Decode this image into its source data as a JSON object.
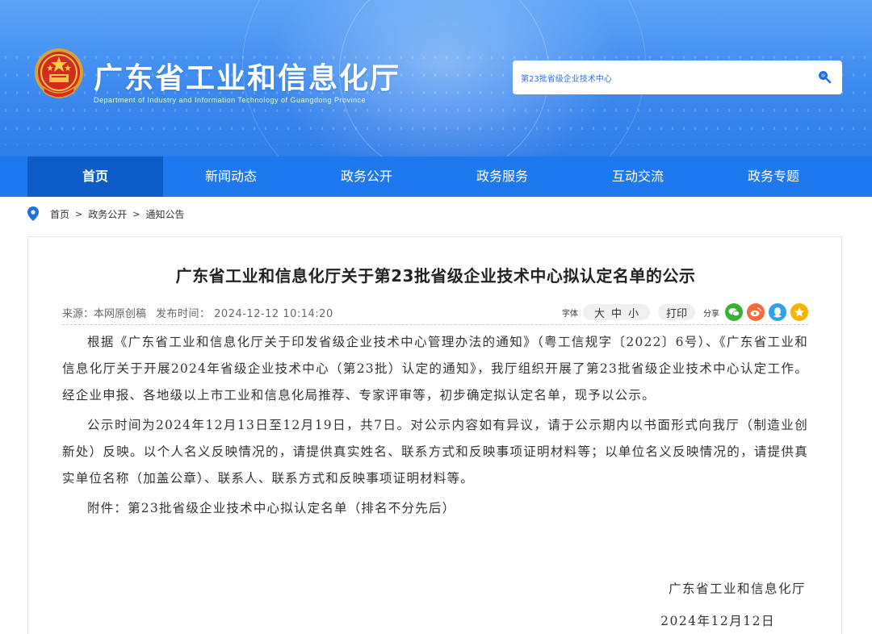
{
  "header": {
    "title": "广东省工业和信息化厅",
    "subtitle": "Department of Industry and Information Technology of Guangdong Province",
    "search": {
      "value": "第23批省级企业技术中心"
    },
    "colors": {
      "banner": "#3d8af0",
      "nav": "#1e78f0",
      "nav_active": "#0e5cc8"
    }
  },
  "nav": {
    "items": [
      {
        "label": "首页",
        "active": true
      },
      {
        "label": "新闻动态"
      },
      {
        "label": "政务公开"
      },
      {
        "label": "政务服务"
      },
      {
        "label": "互动交流"
      },
      {
        "label": "政务专题"
      }
    ]
  },
  "breadcrumb": {
    "items": [
      "首页",
      "政务公开",
      "通知公告"
    ],
    "separator": ">"
  },
  "article": {
    "title": "广东省工业和信息化厅关于第23批省级企业技术中心拟认定名单的公示",
    "source": "来源：本网原创稿",
    "publish_time": "发布时间： 2024-12-12 10:14:20",
    "tools": {
      "font_label": "字体",
      "font_sizes": [
        "大",
        "中",
        "小"
      ],
      "print_label": "打印",
      "share_label": "分享",
      "share_icons": [
        "wechat-icon",
        "weibo-icon",
        "qq-icon",
        "favorite-icon"
      ]
    },
    "paragraphs": [
      "根据《广东省工业和信息化厅关于印发省级企业技术中心管理办法的通知》（粤工信规字〔2022〕6号）、《广东省工业和信息化厅关于开展2024年省级企业技术中心（第23批）认定的通知》，我厅组织开展了第23批省级企业技术中心认定工作。经企业申报、各地级以上市工业和信息化局推荐、专家评审等，初步确定拟认定名单，现予以公示。",
      "公示时间为2024年12月13日至12月19日，共7日。对公示内容如有异议，请于公示期内以书面形式向我厅（制造业创新处）反映。以个人名义反映情况的，请提供真实姓名、联系方式和反映事项证明材料等；以单位名义反映情况的，请提供真实单位名称（加盖公章）、联系人、联系方式和反映事项证明材料等。",
      "附件：第23批省级企业技术中心拟认定名单（排名不分先后）"
    ],
    "signature": "广东省工业和信息化厅",
    "date": "2024年12月12日"
  }
}
